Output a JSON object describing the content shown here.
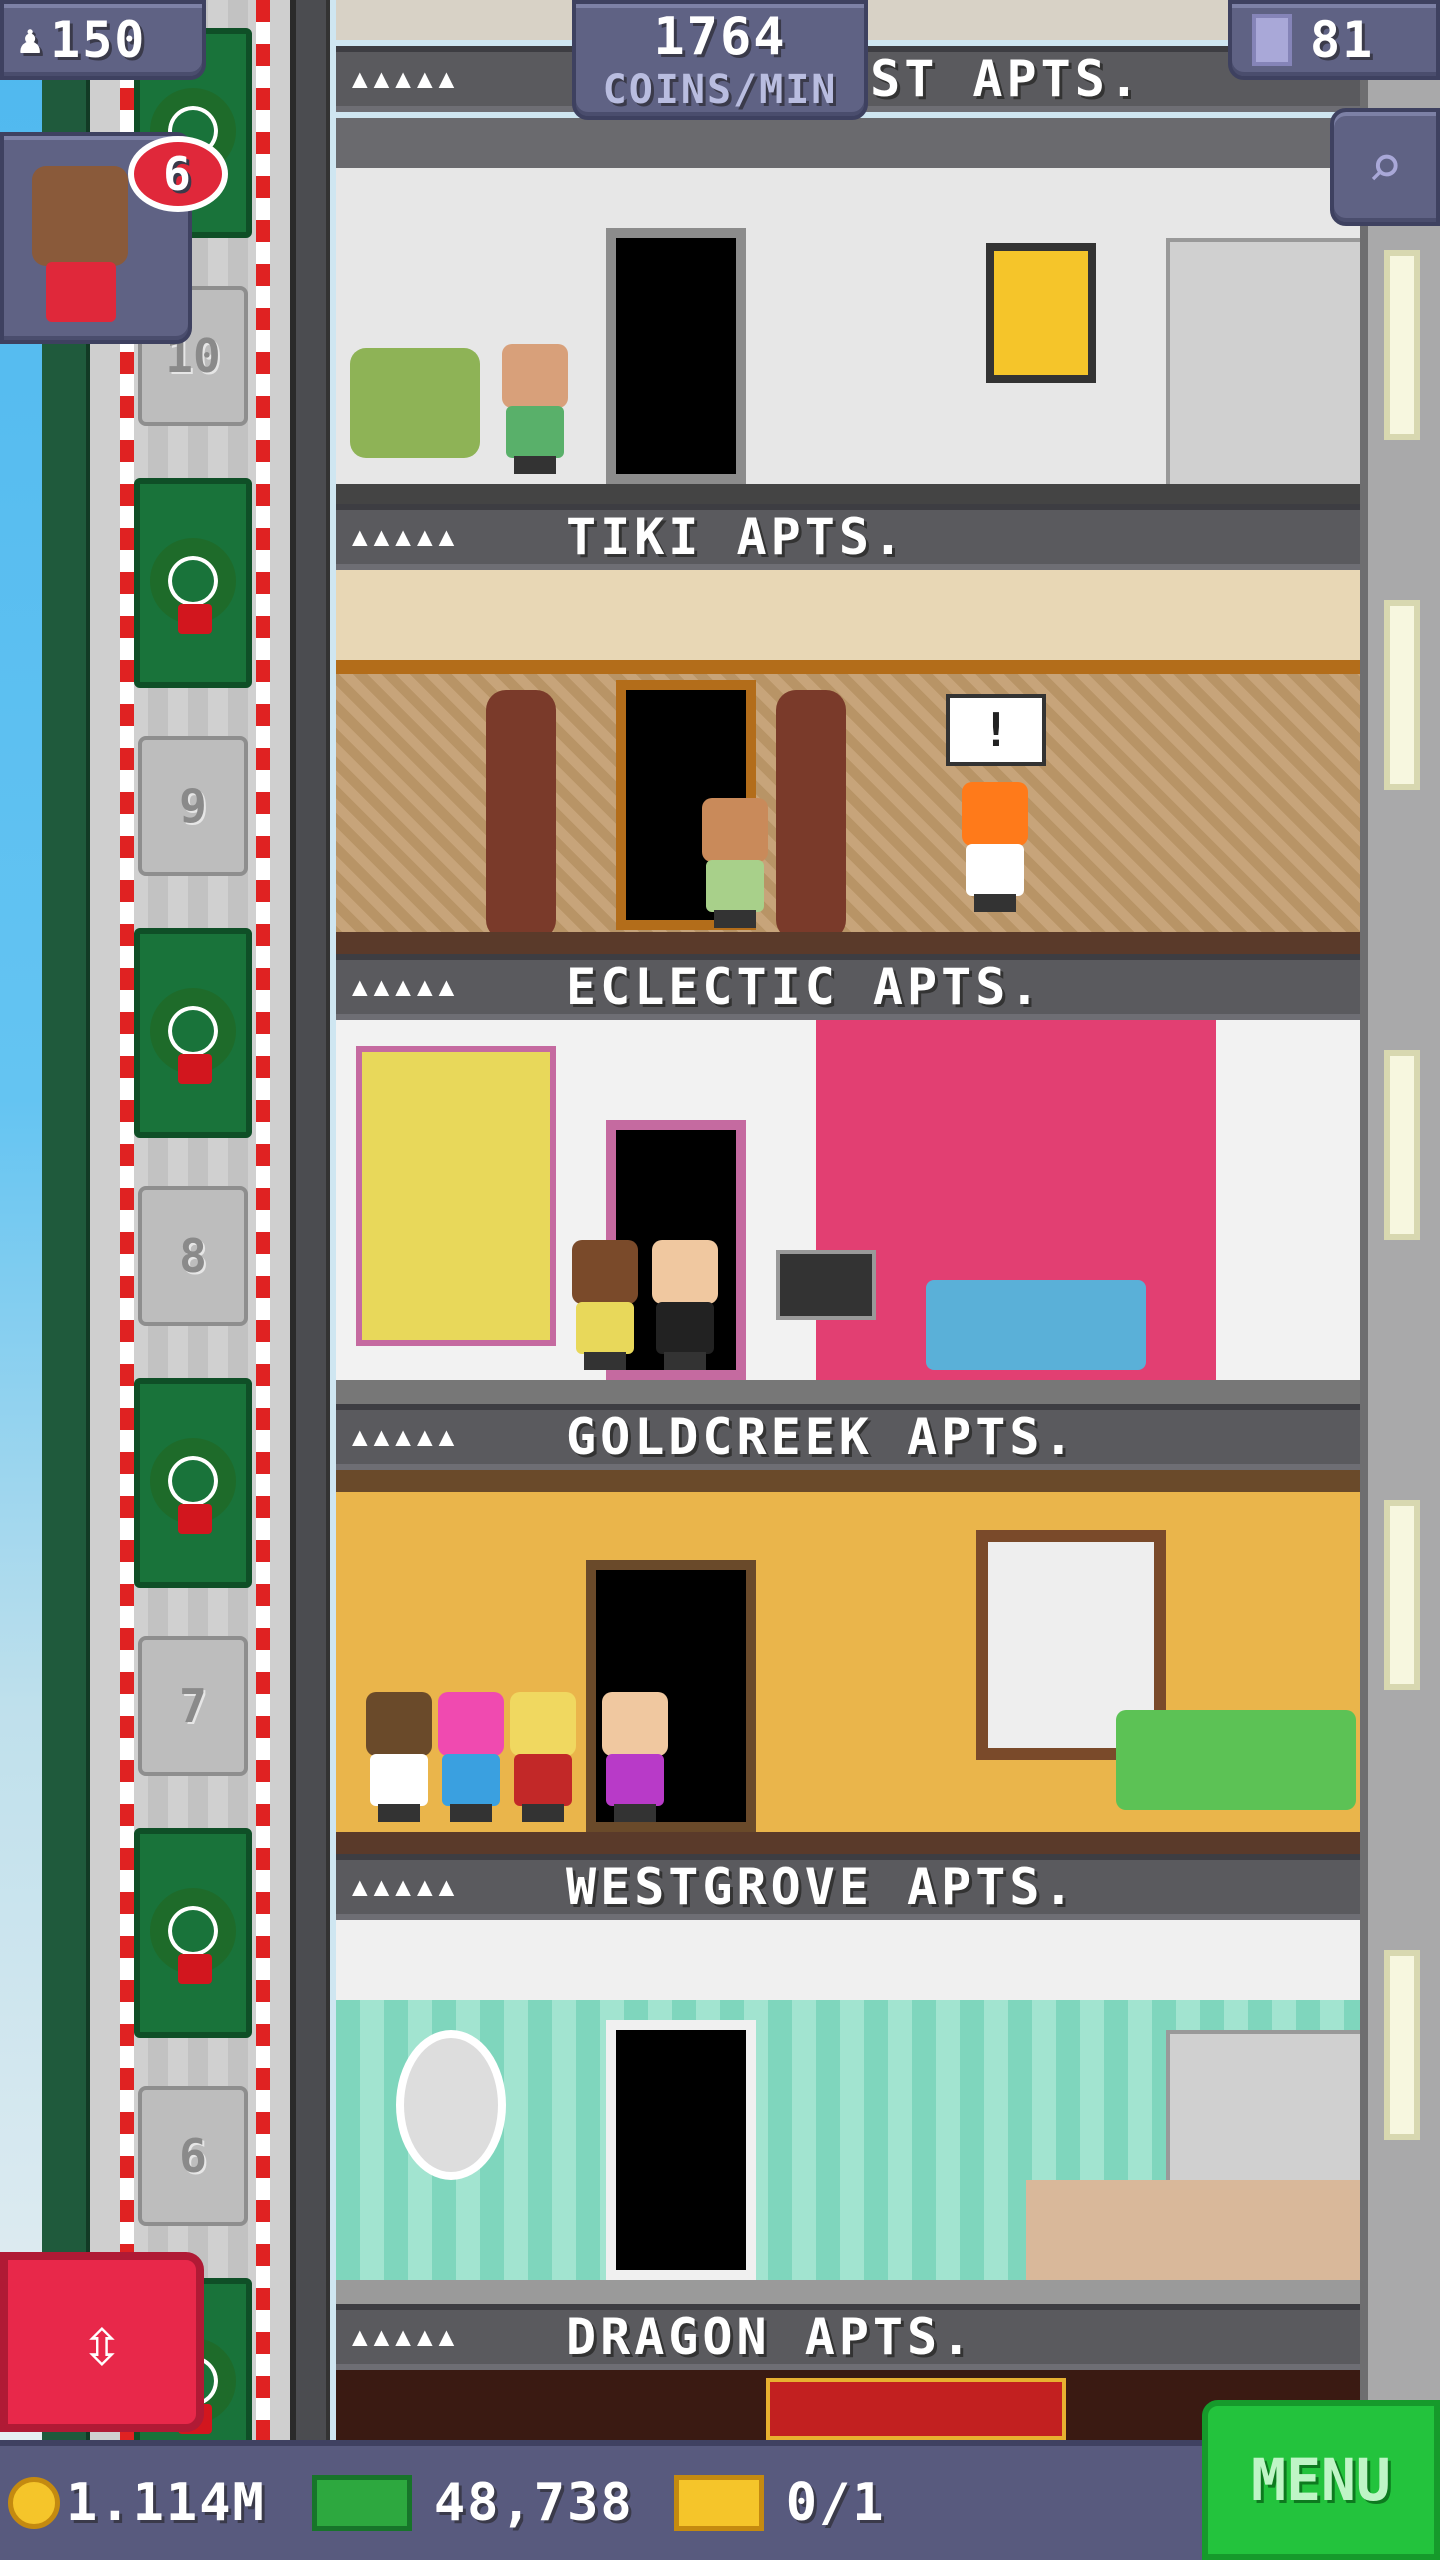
{
  "hud": {
    "population": "150",
    "coins_per_min_value": "1764",
    "coins_per_min_label": "COINS/MIN",
    "floors": "81"
  },
  "notification": {
    "count": "6"
  },
  "elevator": {
    "floor_numbers": [
      "10",
      "9",
      "8",
      "7",
      "6"
    ]
  },
  "floors": [
    {
      "name": "EST APTS.",
      "stars": "▲▲▲▲▲"
    },
    {
      "name": "TIKI APTS.",
      "stars": "▲▲▲▲▲",
      "speech": "!"
    },
    {
      "name": "ECLECTIC APTS.",
      "stars": "▲▲▲▲▲"
    },
    {
      "name": "GOLDCREEK APTS.",
      "stars": "▲▲▲▲▲"
    },
    {
      "name": "WESTGROVE APTS.",
      "stars": "▲▲▲▲▲"
    },
    {
      "name": "DRAGON APTS.",
      "stars": "▲▲▲▲▲"
    }
  ],
  "bottom": {
    "coins": "1.114M",
    "bux": "48,738",
    "tickets": "0/1",
    "menu": "MENU"
  },
  "colors": {
    "hud_panel": "#5f6284",
    "menu_green": "#23c33d",
    "elevator_button": "#e8284a"
  }
}
